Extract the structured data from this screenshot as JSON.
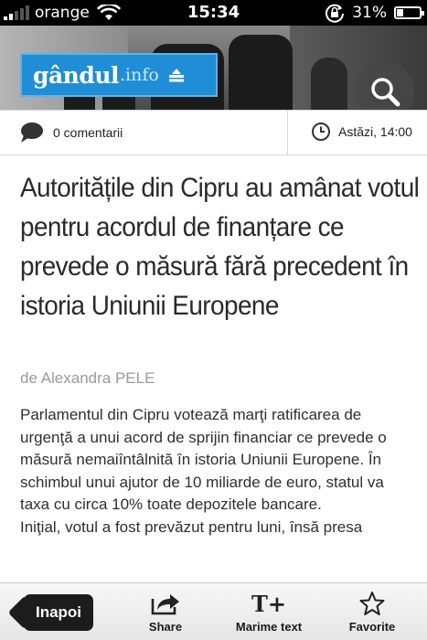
{
  "status_bar": {
    "carrier": "orange",
    "time": "15:34",
    "battery_text": "31%",
    "battery_level": 0.31,
    "signal_bars": 2
  },
  "header": {
    "logo_main": "gândul",
    "logo_suffix": ".info",
    "logo_color": "#1f8ed6"
  },
  "meta": {
    "comments_label": "0 comentarii",
    "date_label": "Astăzi, 14:00"
  },
  "article": {
    "headline": "Autoritățile din Cipru au amânat votul pentru acordul de finanțare ce prevede o măsură fără precedent în istoria Uniunii Europene",
    "byline": "de Alexandra PELE",
    "paragraph_1": "Parlamentul din Cipru votează marţi ratificarea de urgenţă a unui acord de sprijin financiar ce prevede o măsură nemaiîntâlnită în istoria Uniunii Europene. În schimbul unui ajutor de 10 miliarde de euro, statul va taxa cu circa 10% toate depozitele bancare.",
    "paragraph_2": "Iniţial, votul a fost prevăzut pentru luni, însă presa"
  },
  "toolbar": {
    "back_label": "Inapoi",
    "share_label": "Share",
    "text_size_label": "Marime text",
    "favorites_label": "Favorite"
  },
  "icons": {
    "comments": "speech-bubble-icon",
    "date": "clock-icon",
    "search": "search-icon",
    "share": "share-icon",
    "text_size": "text-size-icon",
    "favorites": "star-icon"
  }
}
